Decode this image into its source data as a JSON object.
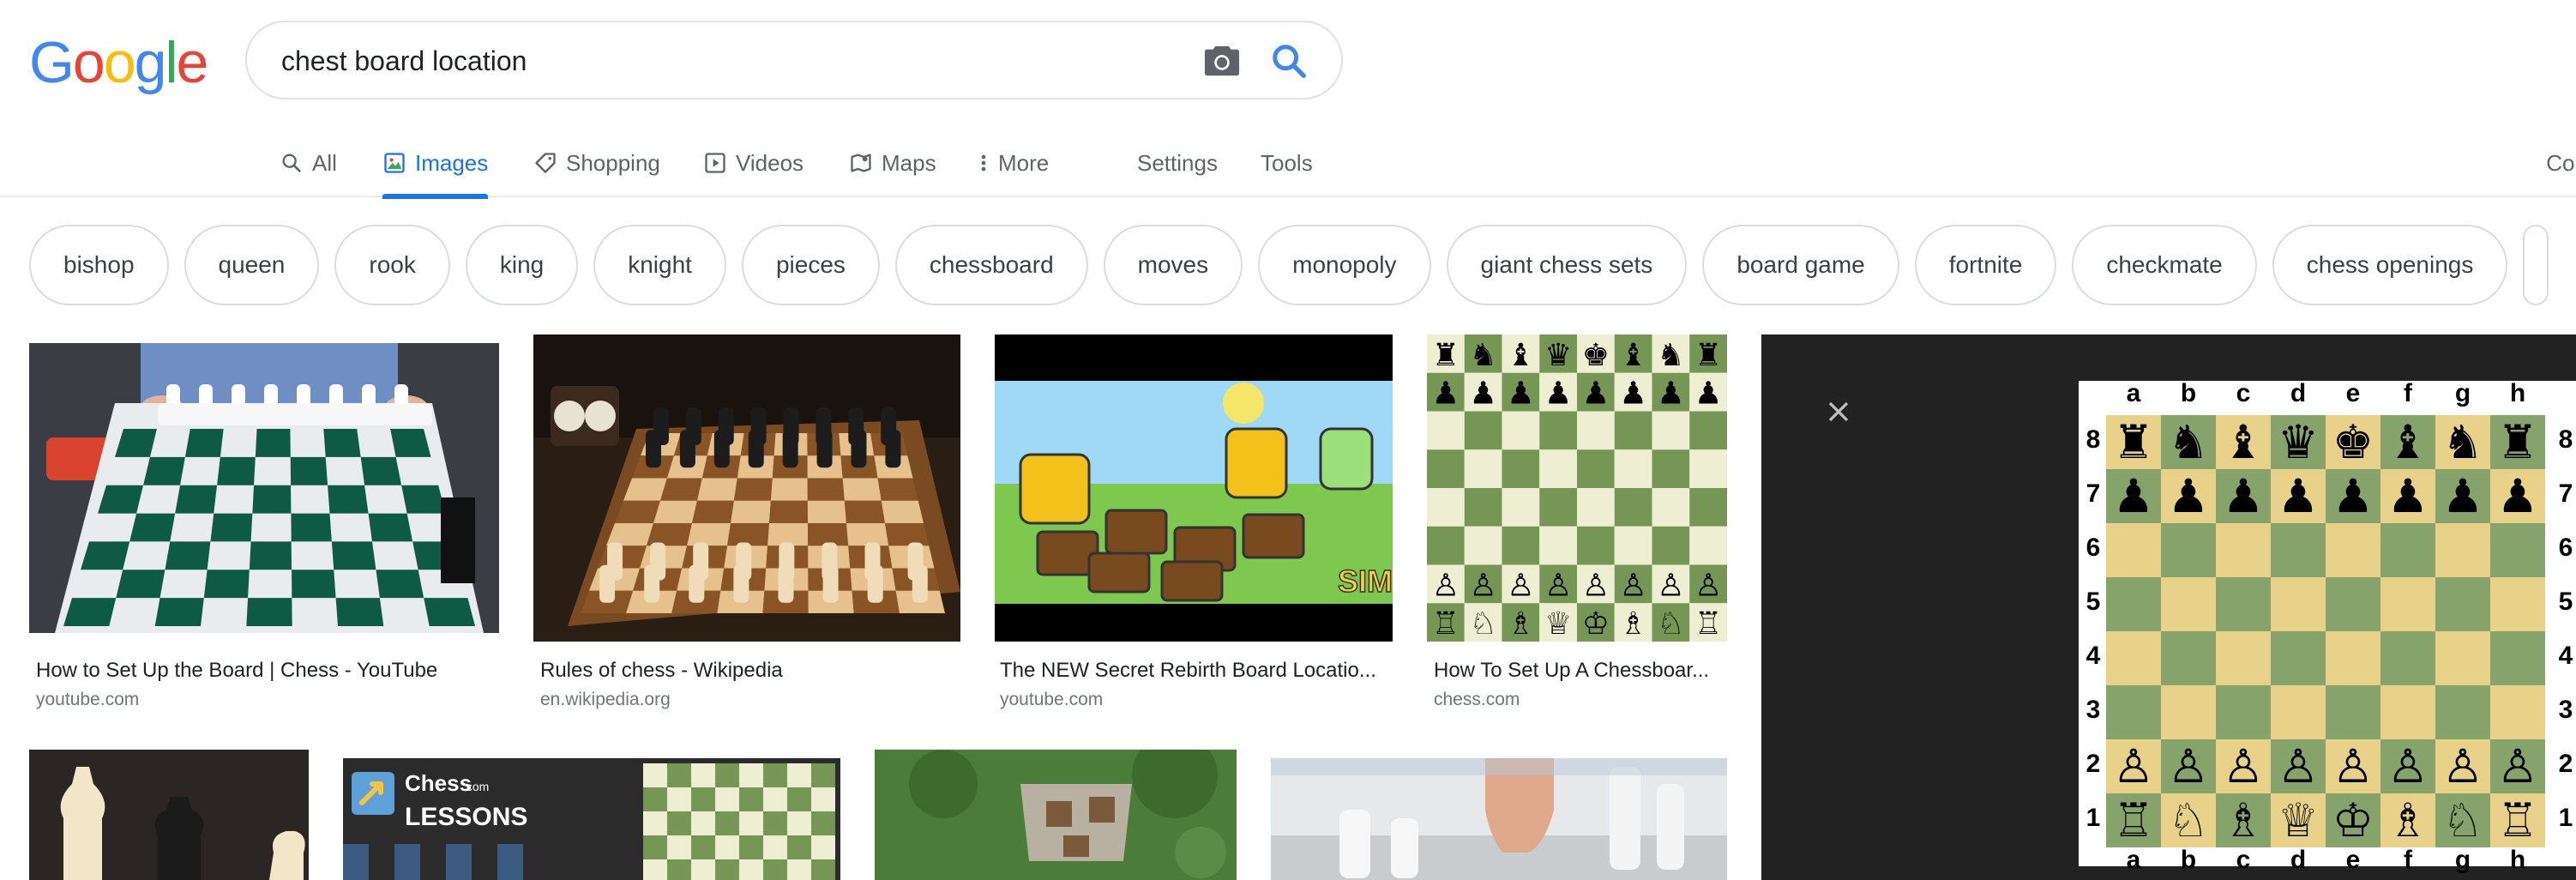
{
  "search": {
    "query": "chest board location"
  },
  "nav": {
    "tabs": [
      "All",
      "Images",
      "Shopping",
      "Videos",
      "Maps",
      "More"
    ],
    "settings": "Settings",
    "tools": "Tools",
    "collections": "Coll"
  },
  "chips": [
    "bishop",
    "queen",
    "rook",
    "king",
    "knight",
    "pieces",
    "chessboard",
    "moves",
    "monopoly",
    "giant chess sets",
    "board game",
    "fortnite",
    "checkmate",
    "chess openings"
  ],
  "results": [
    {
      "title": "How to Set Up the Board | Chess - YouTube",
      "source": "youtube.com"
    },
    {
      "title": "Rules of chess - Wikipedia",
      "source": "en.wikipedia.org"
    },
    {
      "title": "The NEW Secret Rebirth Board Locatio...",
      "source": "youtube.com"
    },
    {
      "title": "How To Set Up A Chessboar...",
      "source": "chess.com"
    }
  ],
  "lessons_thumb": {
    "brand": "Chess",
    "brand_suffix": ".com",
    "caption": "LESSONS"
  },
  "thumb_text": {
    "sim": "SIM"
  },
  "board": {
    "files": [
      "a",
      "b",
      "c",
      "d",
      "e",
      "f",
      "g",
      "h"
    ],
    "ranks": [
      "8",
      "7",
      "6",
      "5",
      "4",
      "3",
      "2",
      "1"
    ],
    "light_color": "#e8d28a",
    "dark_color": "#85a36a"
  },
  "colors": {
    "accent": "#1a73e8",
    "chip_border": "#dadce0",
    "panel_bg": "#222222"
  }
}
